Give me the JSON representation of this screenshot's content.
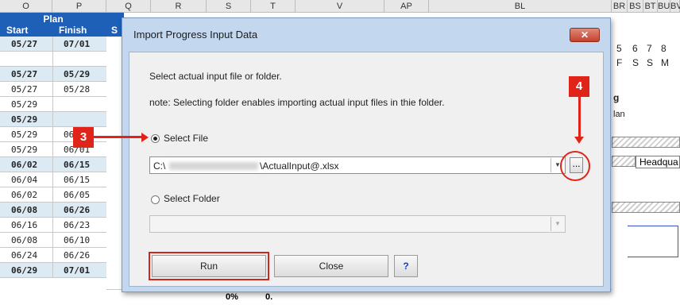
{
  "spreadsheet": {
    "column_headers": [
      "O",
      "P",
      "Q",
      "R",
      "S",
      "T",
      "V",
      "AP",
      "BL",
      "BR",
      "BS",
      "BT",
      "BU",
      "BV"
    ],
    "plan_header": {
      "title": "Plan",
      "start": "Start",
      "finish": "Finish",
      "s": "S"
    },
    "rows": [
      {
        "start": "05/27",
        "finish": "07/01",
        "bold": true
      },
      {
        "start": "",
        "finish": "",
        "bold": false
      },
      {
        "start": "05/27",
        "finish": "05/29",
        "bold": true
      },
      {
        "start": "05/27",
        "finish": "05/28",
        "bold": false
      },
      {
        "start": "05/29",
        "finish": "",
        "bold": false
      },
      {
        "start": "05/29",
        "finish": "",
        "bold": true
      },
      {
        "start": "05/29",
        "finish": "06/03",
        "bold": false
      },
      {
        "start": "05/29",
        "finish": "06/01",
        "bold": false
      },
      {
        "start": "06/02",
        "finish": "06/15",
        "bold": true
      },
      {
        "start": "06/04",
        "finish": "06/15",
        "bold": false
      },
      {
        "start": "06/02",
        "finish": "06/05",
        "bold": false
      },
      {
        "start": "06/08",
        "finish": "06/26",
        "bold": true
      },
      {
        "start": "06/16",
        "finish": "06/23",
        "bold": false
      },
      {
        "start": "06/08",
        "finish": "06/10",
        "bold": false
      },
      {
        "start": "06/24",
        "finish": "06/26",
        "bold": false
      },
      {
        "start": "06/29",
        "finish": "07/01",
        "bold": true
      }
    ],
    "right_days": [
      "5",
      "6",
      "7",
      "8"
    ],
    "right_weekdays": [
      "F",
      "S",
      "S",
      "M"
    ],
    "right_text_g": "g",
    "right_text_lan": "lan",
    "right_text_headqu": "Headqua",
    "bottom_pct": "0%",
    "bottom_zero": "0."
  },
  "dialog": {
    "title": "Import Progress Input Data",
    "close_label": "✕",
    "instruction": "Select actual input file or folder.",
    "note": "note: Selecting folder enables importing actual input files in thie folder.",
    "select_file_label": "Select File",
    "file_path_prefix": "C:\\",
    "file_path_suffix": "\\ActualInput@.xlsx",
    "browse_label": "...",
    "select_folder_label": "Select Folder",
    "folder_value": "",
    "run_label": "Run",
    "close_button_label": "Close",
    "help_label": "?"
  },
  "annotations": {
    "marker_3": "3",
    "marker_4": "4"
  },
  "colors": {
    "plan_header": "#1e5fb8",
    "dialog_frame": "#c3d8ef",
    "highlight": "#e0241a"
  }
}
